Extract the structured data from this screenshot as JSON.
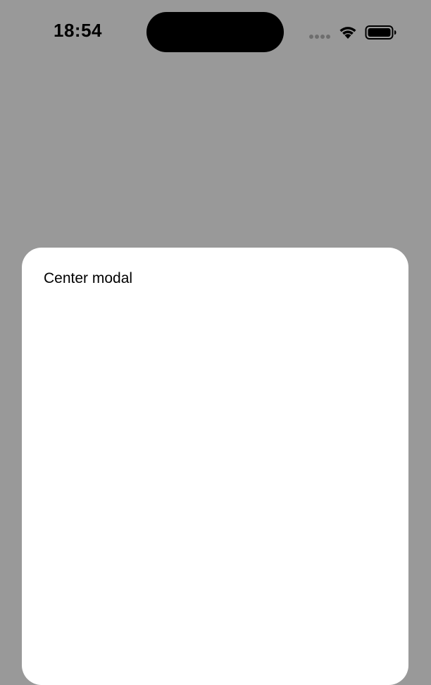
{
  "status_bar": {
    "time": "18:54",
    "icons": [
      "cellular-signal-icon",
      "wifi-icon",
      "battery-icon"
    ]
  },
  "modal": {
    "title": "Center modal"
  },
  "colors": {
    "backdrop": "#999999",
    "modal_background": "#ffffff",
    "text": "#000000"
  }
}
